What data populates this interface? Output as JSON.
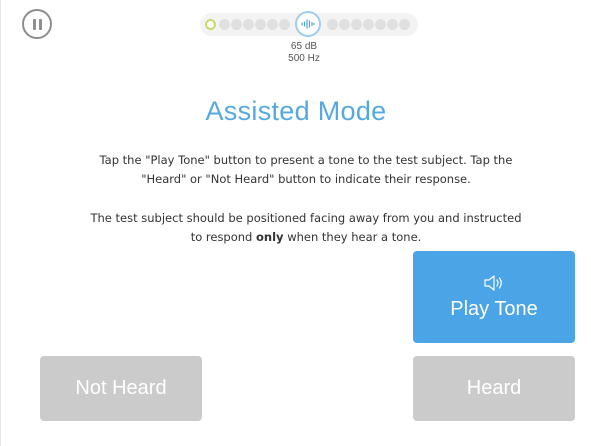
{
  "header": {
    "pause_icon": "pause-icon",
    "progress": {
      "total_steps_left": 7,
      "total_steps_right": 7,
      "current_step": 1,
      "center_icon": "sound-wave-icon",
      "colors": {
        "current_ring": "#c9d86a",
        "inactive_dot": "#e0e0e0",
        "center_ring": "#9fcdf0"
      }
    },
    "level": "65 dB",
    "frequency": "500 Hz"
  },
  "main": {
    "title": "Assisted Mode",
    "instruction_1_line_1": "Tap the \"Play Tone\" button to present a tone to the test subject. Tap the",
    "instruction_1_line_2": "\"Heard\" or \"Not Heard\" button to indicate their response.",
    "instruction_2_line_1": "The test subject should be positioned facing away from you and instructed",
    "instruction_2_before": "to respond ",
    "instruction_2_bold": "only",
    "instruction_2_after": " when they hear a tone."
  },
  "buttons": {
    "play_tone": "Play Tone",
    "play_tone_icon": "speaker-icon",
    "not_heard": "Not Heard",
    "heard": "Heard"
  },
  "colors": {
    "accent": "#4aa4e6",
    "title": "#56a9df",
    "disabled_button": "#cbcbcb"
  }
}
